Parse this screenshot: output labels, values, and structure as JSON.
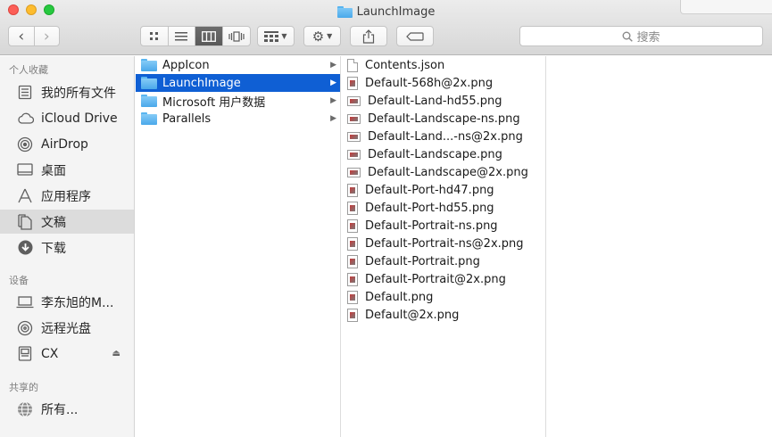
{
  "window": {
    "title": "LaunchImage"
  },
  "toolbar": {
    "search_placeholder": "搜索",
    "nav": {
      "back": "‹",
      "forward": "›"
    }
  },
  "sidebar": {
    "favorites_heading": "个人收藏",
    "favorites": [
      {
        "label": "我的所有文件",
        "icon": "all-files-icon",
        "selected": false
      },
      {
        "label": "iCloud Drive",
        "icon": "cloud-icon",
        "selected": false
      },
      {
        "label": "AirDrop",
        "icon": "airdrop-icon",
        "selected": false
      },
      {
        "label": "桌面",
        "icon": "desktop-icon",
        "selected": false
      },
      {
        "label": "应用程序",
        "icon": "applications-icon",
        "selected": false
      },
      {
        "label": "文稿",
        "icon": "documents-icon",
        "selected": true
      },
      {
        "label": "下载",
        "icon": "download-icon",
        "selected": false
      }
    ],
    "devices_heading": "设备",
    "devices": [
      {
        "label": "李东旭的M...",
        "icon": "laptop-icon"
      },
      {
        "label": "远程光盘",
        "icon": "disc-icon"
      },
      {
        "label": "CX",
        "icon": "drive-icon",
        "ejectable": true
      }
    ],
    "shared_heading": "共享的",
    "shared": [
      {
        "label": "所有...",
        "icon": "network-icon"
      }
    ]
  },
  "column1": [
    {
      "name": "AppIcon",
      "selected": false
    },
    {
      "name": "LaunchImage",
      "selected": true
    },
    {
      "name": "Microsoft 用户数据",
      "selected": false
    },
    {
      "name": "Parallels",
      "selected": false
    }
  ],
  "column2": [
    {
      "name": "Contents.json",
      "kind": "json"
    },
    {
      "name": "Default-568h@2x.png",
      "kind": "portrait"
    },
    {
      "name": "Default-Land-hd55.png",
      "kind": "land"
    },
    {
      "name": "Default-Landscape-ns.png",
      "kind": "land"
    },
    {
      "name": "Default-Land...-ns@2x.png",
      "kind": "land"
    },
    {
      "name": "Default-Landscape.png",
      "kind": "land"
    },
    {
      "name": "Default-Landscape@2x.png",
      "kind": "land"
    },
    {
      "name": "Default-Port-hd47.png",
      "kind": "portrait"
    },
    {
      "name": "Default-Port-hd55.png",
      "kind": "portrait"
    },
    {
      "name": "Default-Portrait-ns.png",
      "kind": "portrait"
    },
    {
      "name": "Default-Portrait-ns@2x.png",
      "kind": "portrait"
    },
    {
      "name": "Default-Portrait.png",
      "kind": "portrait"
    },
    {
      "name": "Default-Portrait@2x.png",
      "kind": "portrait"
    },
    {
      "name": "Default.png",
      "kind": "portrait"
    },
    {
      "name": "Default@2x.png",
      "kind": "portrait"
    }
  ],
  "colors": {
    "selection": "#0f5fd4",
    "sidebar_selection": "#dcdcdc",
    "folder": "#4aa8ea"
  }
}
